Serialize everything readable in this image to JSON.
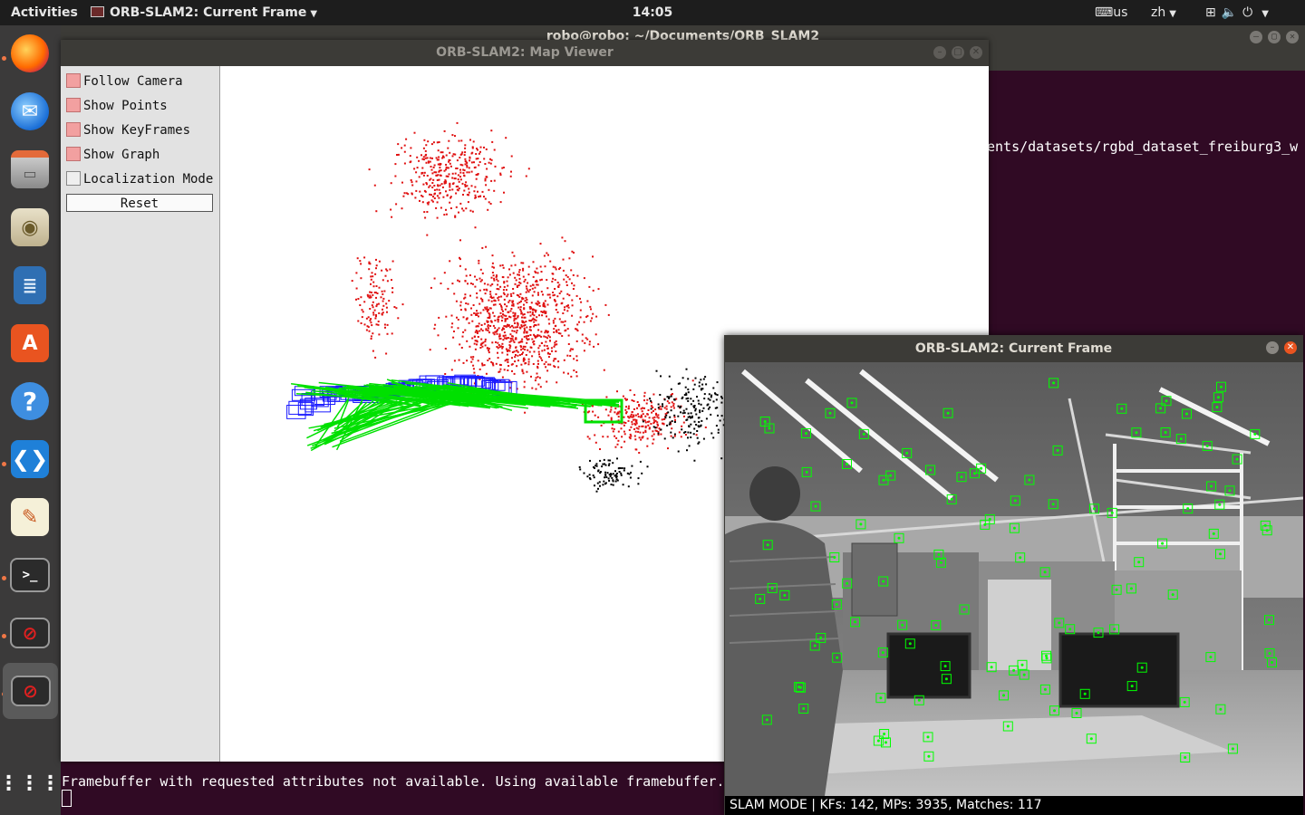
{
  "topbar": {
    "activities": "Activities",
    "app_name": "ORB-SLAM2: Current Frame",
    "clock": "14:05",
    "keyboard": "us",
    "language": "zh"
  },
  "terminal": {
    "title": "robo@robo: ~/Documents/ORB_SLAM2",
    "path_line": "ents/datasets/rgbd_dataset_freiburg3_w",
    "framebuffer_line": "Framebuffer with requested attributes not available. Using available framebuffer."
  },
  "map_viewer": {
    "title": "ORB-SLAM2: Map Viewer",
    "options": [
      {
        "label": "Follow Camera",
        "checked": true
      },
      {
        "label": "Show Points",
        "checked": true
      },
      {
        "label": "Show KeyFrames",
        "checked": true
      },
      {
        "label": "Show Graph",
        "checked": true
      },
      {
        "label": "Localization Mode",
        "checked": false
      }
    ],
    "reset_label": "Reset"
  },
  "current_frame": {
    "title": "ORB-SLAM2: Current Frame",
    "status": "SLAM MODE |  KFs: 142, MPs: 3935, Matches: 117"
  },
  "colors": {
    "map_point": "#e01010",
    "map_point_ref": "#000000",
    "keyframe": "#1a1aff",
    "graph": "#00e000",
    "feature": "#00ff00"
  },
  "dock": {
    "apps": [
      "firefox-icon",
      "thunderbird-icon",
      "files-icon",
      "rhythmbox-icon",
      "writer-icon",
      "software-icon",
      "help-icon",
      "vscode-icon",
      "text-editor-icon",
      "terminal-icon",
      "blocked-app-icon",
      "blocked-app-icon",
      "app-grid-icon"
    ]
  }
}
